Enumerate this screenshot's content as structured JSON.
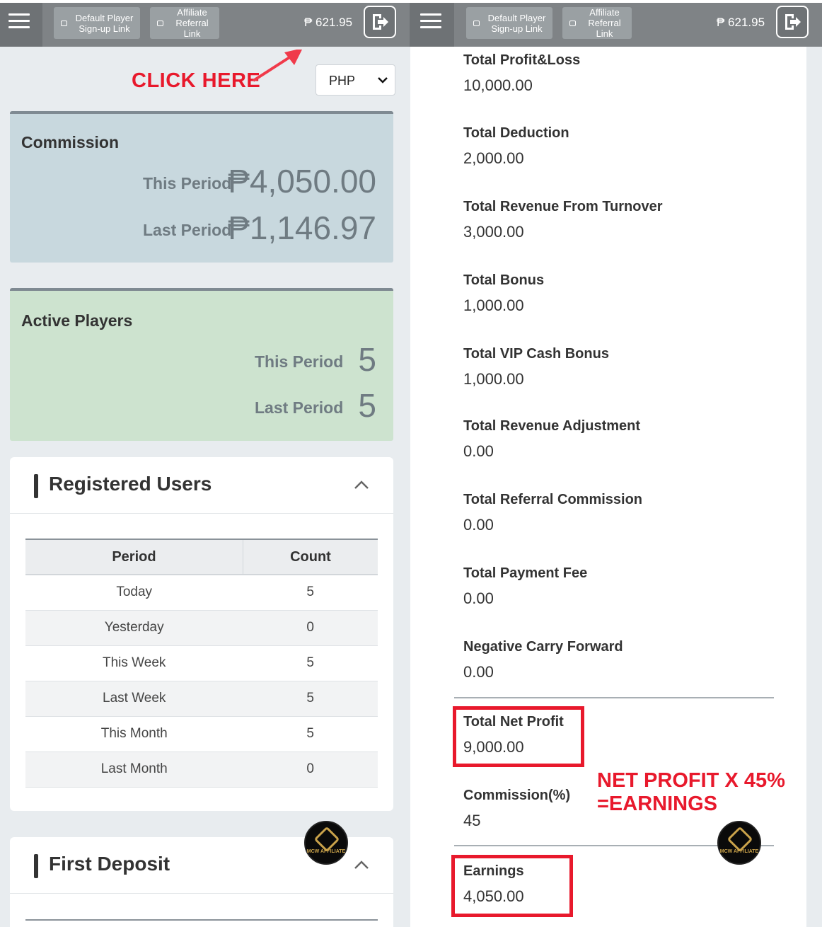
{
  "topbar": {
    "default_player_link": "Default Player Sign-up Link",
    "affiliate_referral_link": "Affiliate Referral Link",
    "balance": "₱ 621.95"
  },
  "annotation": {
    "click_here": "CLICK HERE",
    "note_line1": "NET PROFIT X 45%",
    "note_line2": "=EARNINGS"
  },
  "currency": {
    "selected": "PHP"
  },
  "commission": {
    "title": "Commission",
    "this_period_label": "This Period",
    "this_period_value": "₱4,050.00",
    "last_period_label": "Last Period",
    "last_period_value": "₱1,146.97"
  },
  "active_players": {
    "title": "Active Players",
    "this_period_label": "This Period",
    "this_period_value": "5",
    "last_period_label": "Last Period",
    "last_period_value": "5"
  },
  "registered_users": {
    "title": "Registered Users",
    "columns": [
      "Period",
      "Count"
    ],
    "rows": [
      {
        "period": "Today",
        "count": "5"
      },
      {
        "period": "Yesterday",
        "count": "0"
      },
      {
        "period": "This Week",
        "count": "5"
      },
      {
        "period": "Last Week",
        "count": "5"
      },
      {
        "period": "This Month",
        "count": "5"
      },
      {
        "period": "Last Month",
        "count": "0"
      }
    ]
  },
  "first_deposit": {
    "title": "First Deposit"
  },
  "fab": {
    "label": "MCW AFFILIATE"
  },
  "summary": {
    "total_profit_loss": {
      "label": "Total Profit&Loss",
      "value": "10,000.00"
    },
    "total_deduction": {
      "label": "Total Deduction",
      "value": "2,000.00"
    },
    "total_revenue_turnover": {
      "label": "Total Revenue From Turnover",
      "value": "3,000.00"
    },
    "total_bonus": {
      "label": "Total Bonus",
      "value": "1,000.00"
    },
    "total_vip_cash_bonus": {
      "label": "Total VIP Cash Bonus",
      "value": "1,000.00"
    },
    "total_revenue_adjustment": {
      "label": "Total Revenue Adjustment",
      "value": "0.00"
    },
    "total_referral_commission": {
      "label": "Total Referral Commission",
      "value": "0.00"
    },
    "total_payment_fee": {
      "label": "Total Payment Fee",
      "value": "0.00"
    },
    "negative_carry_forward": {
      "label": "Negative Carry Forward",
      "value": "0.00"
    },
    "total_net_profit": {
      "label": "Total Net Profit",
      "value": "9,000.00"
    },
    "commission_percent": {
      "label": "Commission(%)",
      "value": "45"
    },
    "earnings": {
      "label": "Earnings",
      "value": "4,050.00"
    }
  },
  "colors": {
    "annotation_red": "#e8192c",
    "topbar": "#6e7275",
    "commission_card": "#c8d8de",
    "active_card": "#cde3cf"
  }
}
